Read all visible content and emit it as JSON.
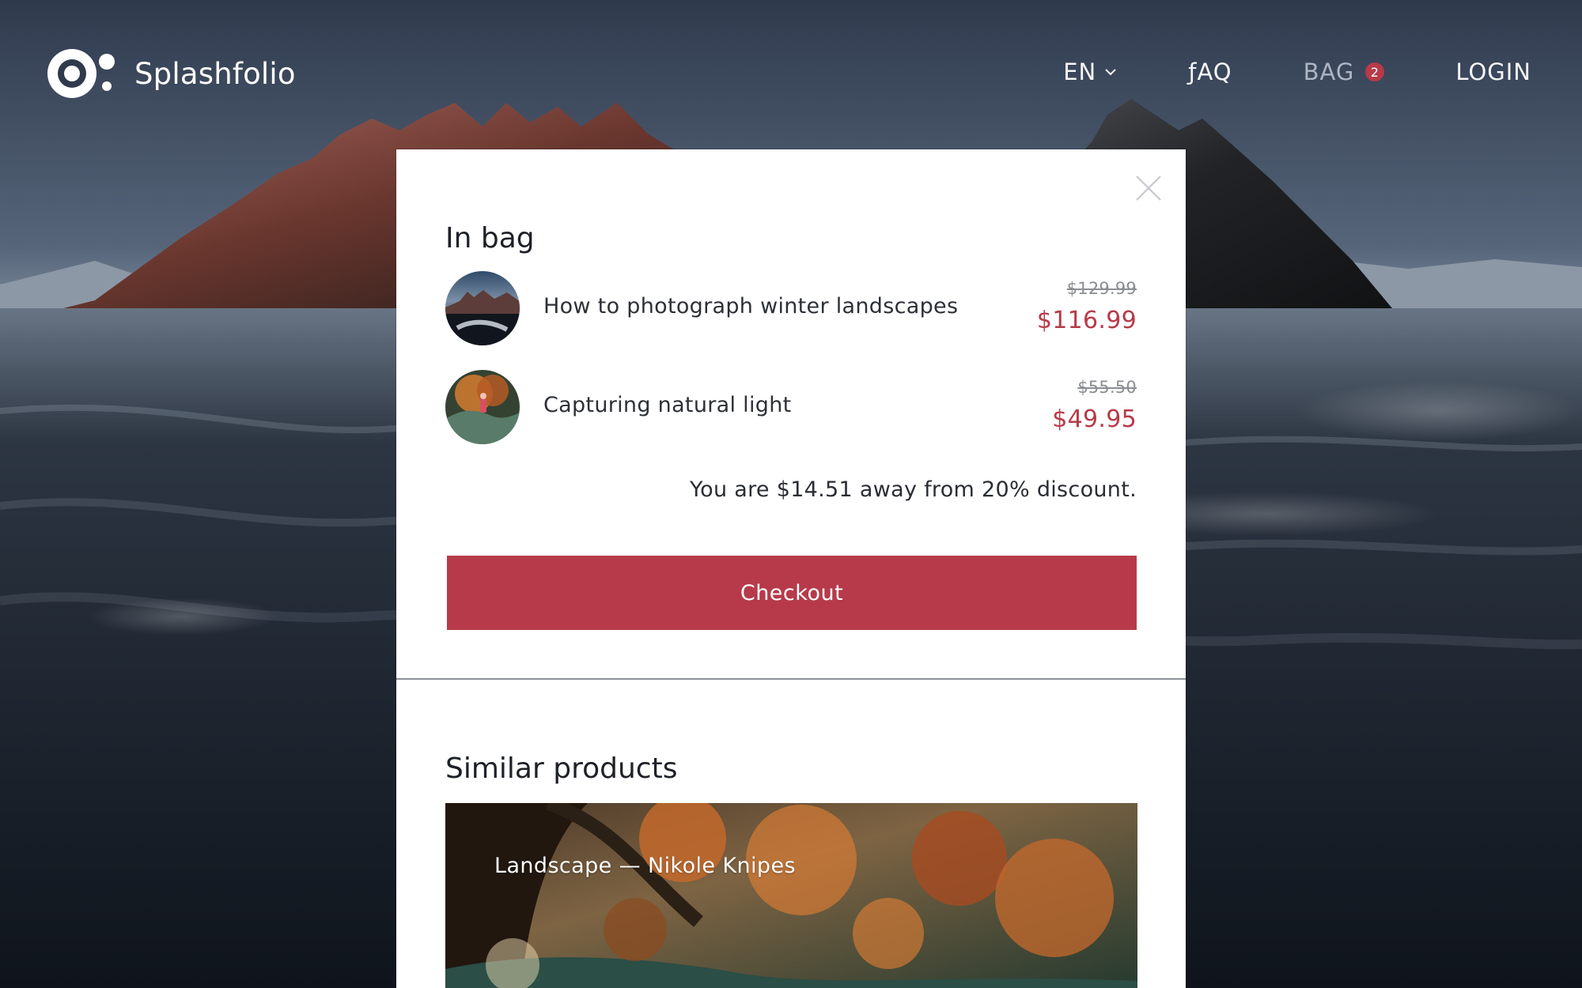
{
  "app": {
    "brand_name": "Splashfolio",
    "accent_color": "#b63a4a"
  },
  "nav": {
    "language_label": "EN",
    "faq_label": "ƒAQ",
    "bag_label": "BAG",
    "bag_count": "2",
    "login_label": "LOGIN"
  },
  "bag_modal": {
    "title": "In bag",
    "items": [
      {
        "title": "How to photograph winter landscapes",
        "old_price": "$129.99",
        "new_price": "$116.99",
        "thumbnail_icon": "winter-landscape-thumbnail"
      },
      {
        "title": "Capturing natural light",
        "old_price": "$55.50",
        "new_price": "$49.95",
        "thumbnail_icon": "natural-light-thumbnail"
      }
    ],
    "discount_note": "You are $14.51 away from 20% discount.",
    "checkout_label": "Checkout"
  },
  "similar_products": {
    "title": "Similar products",
    "cards": [
      {
        "caption": "Landscape — Nikole Knipes"
      }
    ]
  },
  "icons": {
    "brand_logo": "brand-logo-icon",
    "language_dropdown": "chevron-down-icon",
    "close": "close-icon"
  }
}
